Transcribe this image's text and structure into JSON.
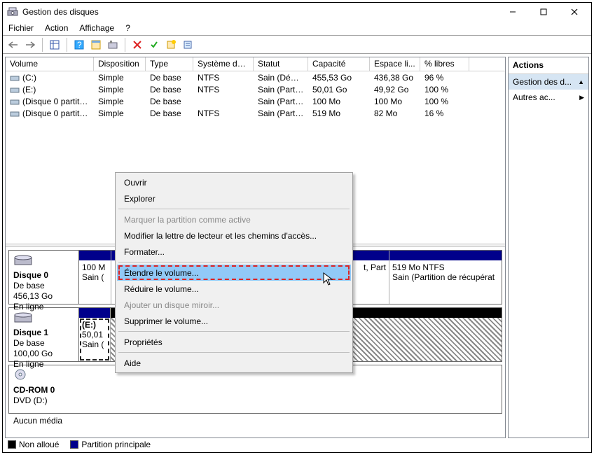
{
  "window": {
    "title": "Gestion des disques"
  },
  "menu": {
    "file": "Fichier",
    "action": "Action",
    "view": "Affichage",
    "help": "?"
  },
  "columns": {
    "volume": "Volume",
    "layout": "Disposition",
    "type": "Type",
    "fs": "Système de ...",
    "status": "Statut",
    "capacity": "Capacité",
    "free": "Espace li...",
    "pct": "% libres"
  },
  "volumes": [
    {
      "name": "(C:)",
      "layout": "Simple",
      "type": "De base",
      "fs": "NTFS",
      "status": "Sain (Dém...",
      "cap": "455,53 Go",
      "free": "436,38 Go",
      "pct": "96 %"
    },
    {
      "name": "(E:)",
      "layout": "Simple",
      "type": "De base",
      "fs": "NTFS",
      "status": "Sain (Parti...",
      "cap": "50,01 Go",
      "free": "49,92 Go",
      "pct": "100 %"
    },
    {
      "name": "(Disque 0 partition...",
      "layout": "Simple",
      "type": "De base",
      "fs": "",
      "status": "Sain (Parti...",
      "cap": "100 Mo",
      "free": "100 Mo",
      "pct": "100 %"
    },
    {
      "name": "(Disque 0 partition...",
      "layout": "Simple",
      "type": "De base",
      "fs": "NTFS",
      "status": "Sain (Parti...",
      "cap": "519 Mo",
      "free": "82 Mo",
      "pct": "16 %"
    }
  ],
  "disks": {
    "d0": {
      "title": "Disque 0",
      "l1": "De base",
      "l2": "456,13 Go",
      "l3": "En ligne"
    },
    "d0parts": {
      "p1": {
        "a": "100 M",
        "b": "Sain ("
      },
      "p2": {
        "a": "t, Part"
      },
      "p3": {
        "a": "519 Mo NTFS",
        "b": "Sain (Partition de récupérat"
      }
    },
    "d1": {
      "title": "Disque 1",
      "l1": "De base",
      "l2": "100,00 Go",
      "l3": "En ligne"
    },
    "d1parts": {
      "p1": {
        "a": "(E:)",
        "b": "50,01",
        "c": "Sain ("
      }
    },
    "cd": {
      "title": "CD-ROM 0",
      "l1": "DVD (D:)",
      "l2": "",
      "l3": "Aucun média"
    }
  },
  "legend": {
    "unalloc": "Non alloué",
    "primary": "Partition principale"
  },
  "actions": {
    "title": "Actions",
    "row1": "Gestion des d...",
    "row2": "Autres ac..."
  },
  "ctx": {
    "open": "Ouvrir",
    "explore": "Explorer",
    "markactive": "Marquer la partition comme active",
    "changeletter": "Modifier la lettre de lecteur et les chemins d'accès...",
    "format": "Formater...",
    "extend": "Étendre le volume...",
    "shrink": "Réduire le volume...",
    "mirror": "Ajouter un disque miroir...",
    "delete": "Supprimer le volume...",
    "props": "Propriétés",
    "help": "Aide"
  }
}
